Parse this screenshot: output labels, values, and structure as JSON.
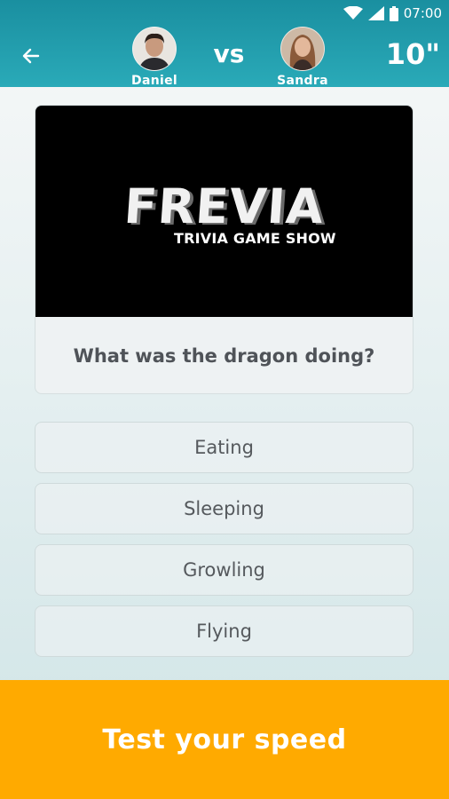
{
  "status_bar": {
    "time": "07:00"
  },
  "header": {
    "player1": {
      "name": "Daniel"
    },
    "vs_label": "vs",
    "player2": {
      "name": "Sandra"
    },
    "timer": "10\""
  },
  "media": {
    "logo_title": "FREVIA",
    "logo_subtitle": "TRIVIA GAME SHOW"
  },
  "question": {
    "text": "What was the dragon doing?"
  },
  "answers": [
    {
      "label": "Eating"
    },
    {
      "label": "Sleeping"
    },
    {
      "label": "Growling"
    },
    {
      "label": "Flying"
    }
  ],
  "cta": {
    "label": "Test your speed"
  },
  "colors": {
    "header": "#2aaab8",
    "cta": "#ffaa00",
    "text": "#4f5358"
  }
}
